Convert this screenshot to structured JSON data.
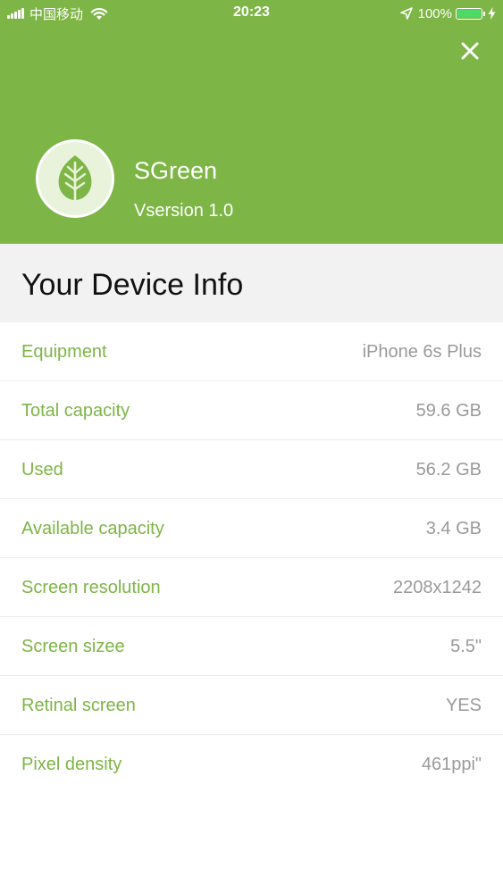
{
  "status_bar": {
    "carrier": "中国移动",
    "time": "20:23",
    "battery_percent": "100%"
  },
  "header": {
    "app_name": "SGreen",
    "app_version": "Vsersion 1.0",
    "background_color": "#7db546"
  },
  "icons": {
    "close": "close-icon",
    "logo": "leaf-icon",
    "location": "location-arrow-icon",
    "wifi": "wifi-icon",
    "battery": "battery-icon",
    "charging": "charging-bolt-icon"
  },
  "section": {
    "title": "Your Device Info"
  },
  "device_info": {
    "rows": [
      {
        "label": "Equipment",
        "value": "iPhone 6s Plus"
      },
      {
        "label": "Total capacity",
        "value": "59.6 GB"
      },
      {
        "label": "Used",
        "value": "56.2 GB"
      },
      {
        "label": "Available capacity",
        "value": "3.4 GB"
      },
      {
        "label": "Screen resolution",
        "value": "2208x1242"
      },
      {
        "label": "Screen sizee",
        "value": "5.5\""
      },
      {
        "label": "Retinal screen",
        "value": "YES"
      },
      {
        "label": "Pixel density",
        "value": "461ppi\""
      }
    ]
  },
  "colors": {
    "accent": "#7db546",
    "value_text": "#9a9a9a",
    "section_bg": "#f2f2f2"
  }
}
